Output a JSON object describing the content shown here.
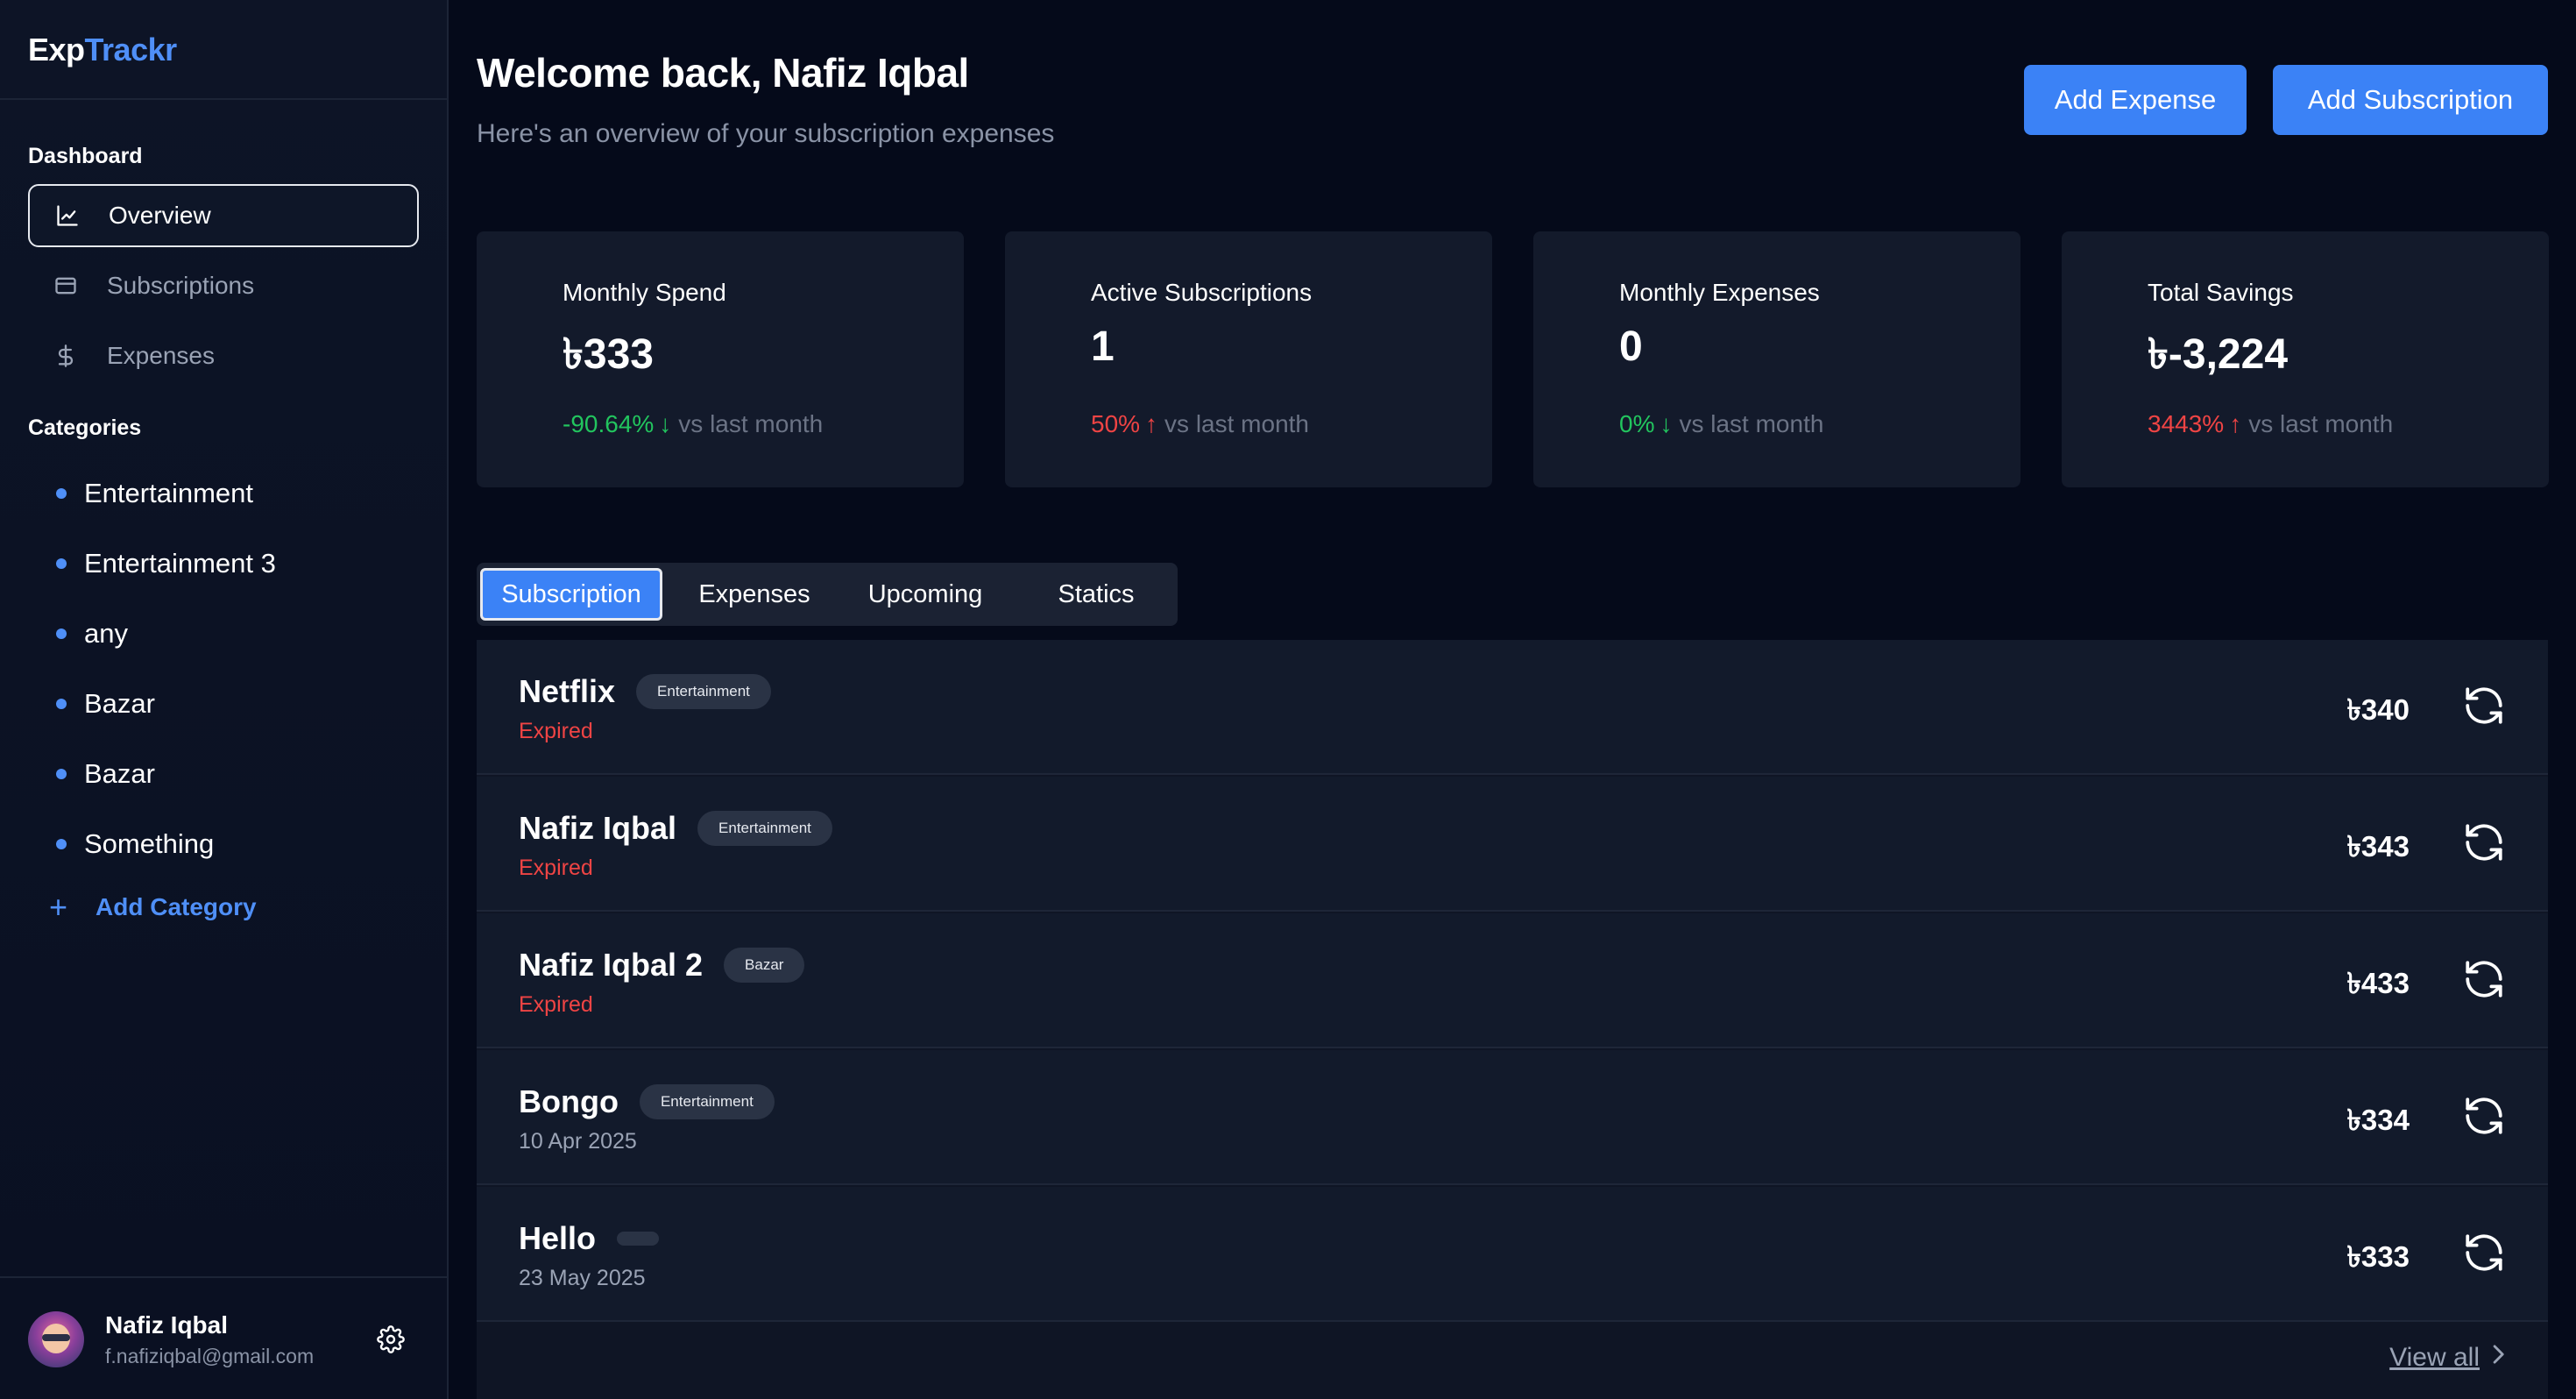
{
  "brand": {
    "part1": "Exp",
    "part2": "Trackr"
  },
  "sidebar": {
    "dashboard_label": "Dashboard",
    "nav": [
      {
        "label": "Overview",
        "icon": "chart-line-icon",
        "active": true
      },
      {
        "label": "Subscriptions",
        "icon": "credit-card-icon",
        "active": false
      },
      {
        "label": "Expenses",
        "icon": "dollar-icon",
        "active": false
      }
    ],
    "categories_label": "Categories",
    "categories": [
      "Entertainment",
      "Entertainment 3",
      "any",
      "Bazar",
      "Bazar",
      "Something"
    ],
    "add_category": "Add Category",
    "category_dot_color": "#4f8ff7"
  },
  "profile": {
    "name": "Nafiz Iqbal",
    "email": "f.nafiziqbal@gmail.com"
  },
  "header": {
    "welcome": "Welcome back, Nafiz Iqbal",
    "subtitle": "Here's an overview of your subscription expenses",
    "add_expense": "Add Expense",
    "add_subscription": "Add Subscription"
  },
  "stats": [
    {
      "title": "Monthly Spend",
      "value": "৳333",
      "pct": "-90.64%",
      "dir": "down",
      "color": "green",
      "vs": "vs last month"
    },
    {
      "title": "Active Subscriptions",
      "value": "1",
      "pct": "50%",
      "dir": "up",
      "color": "red",
      "vs": "vs last month"
    },
    {
      "title": "Monthly Expenses",
      "value": "0",
      "pct": "0%",
      "dir": "down",
      "color": "green",
      "vs": "vs last month"
    },
    {
      "title": "Total Savings",
      "value": "৳-3,224",
      "pct": "3443%",
      "dir": "up",
      "color": "red",
      "vs": "vs last month"
    }
  ],
  "tabs": [
    "Subscription",
    "Expenses",
    "Upcoming",
    "Statics"
  ],
  "active_tab": "Subscription",
  "subscriptions": [
    {
      "name": "Netflix",
      "category": "Entertainment",
      "status": "Expired",
      "amount": "৳340"
    },
    {
      "name": "Nafiz Iqbal",
      "category": "Entertainment",
      "status": "Expired",
      "amount": "৳343"
    },
    {
      "name": "Nafiz Iqbal 2",
      "category": "Bazar",
      "status": "Expired",
      "amount": "৳433"
    },
    {
      "name": "Bongo",
      "category": "Entertainment",
      "status": "10 Apr 2025",
      "amount": "৳334"
    },
    {
      "name": "Hello",
      "category": "",
      "status": "23 May 2025",
      "amount": "৳333"
    }
  ],
  "view_all": "View all",
  "colors": {
    "accent": "#3b82f6",
    "positive": "#22c55e",
    "negative": "#ef4444",
    "background": "#050a1a",
    "card": "#131a2b"
  }
}
